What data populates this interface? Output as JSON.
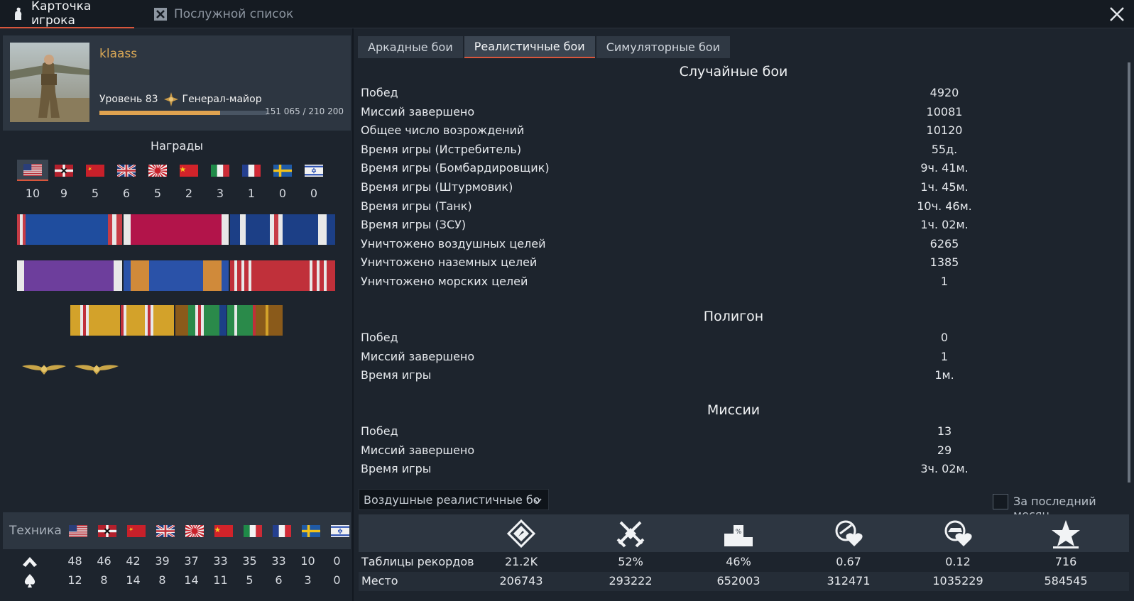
{
  "tabs": {
    "player_card": "Карточка игрока",
    "service_record": "Послужной список"
  },
  "profile": {
    "nickname": "klaass",
    "level_label": "Уровень 83",
    "rank": "Генерал-майор",
    "xp_text": "151 065 / 210 200",
    "xp_fraction": 0.7187
  },
  "awards": {
    "title": "Награды",
    "counts": [
      "10",
      "9",
      "5",
      "6",
      "5",
      "2",
      "3",
      "1",
      "0",
      "0"
    ]
  },
  "countries": [
    "usa",
    "germany",
    "ussr",
    "britain",
    "japan",
    "china",
    "italy",
    "france",
    "sweden",
    "israel"
  ],
  "technique": {
    "label": "Техника",
    "row_total_icon": "chevron-up-icon",
    "row_spades_icon": "spade-icon",
    "total": [
      "48",
      "46",
      "42",
      "39",
      "37",
      "33",
      "35",
      "33",
      "10",
      "0"
    ],
    "elite": [
      "12",
      "8",
      "14",
      "8",
      "14",
      "11",
      "5",
      "6",
      "3",
      "0"
    ]
  },
  "modes": {
    "arcade": "Аркадные бои",
    "realistic": "Реалистичные бои",
    "simulator": "Симуляторные бои"
  },
  "sections": {
    "random": {
      "title": "Случайные бои",
      "rows": [
        {
          "label": "Побед",
          "value": "4920"
        },
        {
          "label": "Миссий завершено",
          "value": "10081"
        },
        {
          "label": "Общее число возрождений",
          "value": "10120"
        },
        {
          "label": "Время игры (Истребитель)",
          "value": "55д."
        },
        {
          "label": "Время игры (Бомбардировщик)",
          "value": "9ч. 41м."
        },
        {
          "label": "Время игры (Штурмовик)",
          "value": "1ч. 45м."
        },
        {
          "label": "Время игры (Танк)",
          "value": "10ч. 46м."
        },
        {
          "label": "Время игры (ЗСУ)",
          "value": "1ч. 02м."
        },
        {
          "label": "Уничтожено воздушных целей",
          "value": "6265"
        },
        {
          "label": "Уничтожено наземных целей",
          "value": "1385"
        },
        {
          "label": "Уничтожено морских целей",
          "value": "1"
        }
      ]
    },
    "polygon": {
      "title": "Полигон",
      "rows": [
        {
          "label": "Побед",
          "value": "0"
        },
        {
          "label": "Миссий завершено",
          "value": "1"
        },
        {
          "label": "Время игры",
          "value": "1м."
        }
      ]
    },
    "missions": {
      "title": "Миссии",
      "rows": [
        {
          "label": "Побед",
          "value": "13"
        },
        {
          "label": "Миссий завершено",
          "value": "29"
        },
        {
          "label": "Время игры",
          "value": "3ч. 02м."
        }
      ]
    }
  },
  "leaderboard": {
    "dropdown_value": "Воздушные реалистичные бо",
    "last_month_label": "За последний месяц",
    "icons": [
      "battles-icon",
      "victories-icon",
      "podium-icon",
      "kills-per-death-icon",
      "ground-kills-per-death-icon",
      "star-icon"
    ],
    "records_label": "Таблицы рекордов",
    "records": [
      "21.2K",
      "52%",
      "46%",
      "0.67",
      "0.12",
      "716"
    ],
    "place_label": "Место",
    "places": [
      "206743",
      "293222",
      "652003",
      "312471",
      "1035229",
      "584545"
    ]
  }
}
